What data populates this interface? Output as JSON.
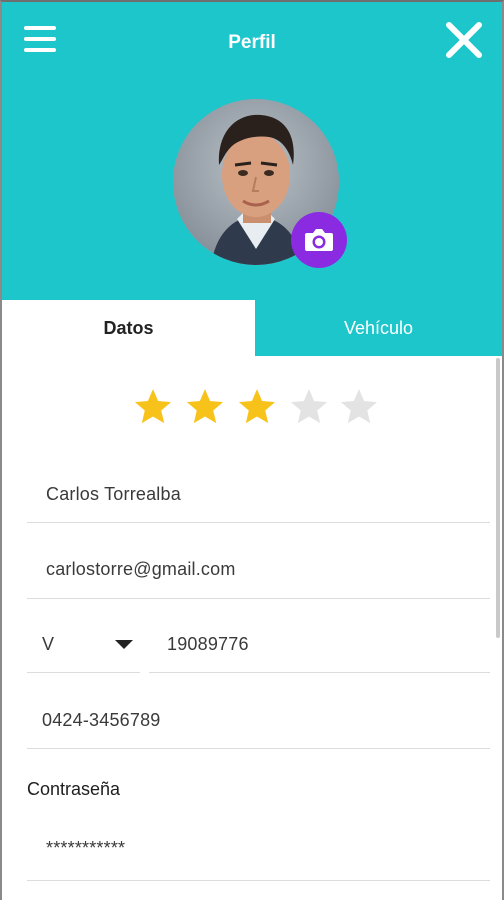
{
  "header": {
    "title": "Perfil",
    "menu_icon": "hamburger-menu-icon",
    "close_icon": "close-icon",
    "background_color": "#1cc6cb"
  },
  "profile": {
    "camera_icon": "camera-icon",
    "camera_button_color": "#8a2be2"
  },
  "tabs": [
    {
      "label": "Datos",
      "active": true
    },
    {
      "label": "Vehículo",
      "active": false
    }
  ],
  "rating": {
    "value": 3,
    "max": 5,
    "filled_color": "#f7c21a",
    "empty_color": "#e3e3e3"
  },
  "form": {
    "name": "Carlos Torrealba",
    "email": "carlostorre@gmail.com",
    "id_type": "V",
    "id_number": "19089776",
    "phone": "0424-3456789",
    "password_label": "Contraseña",
    "password_value": "***********"
  }
}
